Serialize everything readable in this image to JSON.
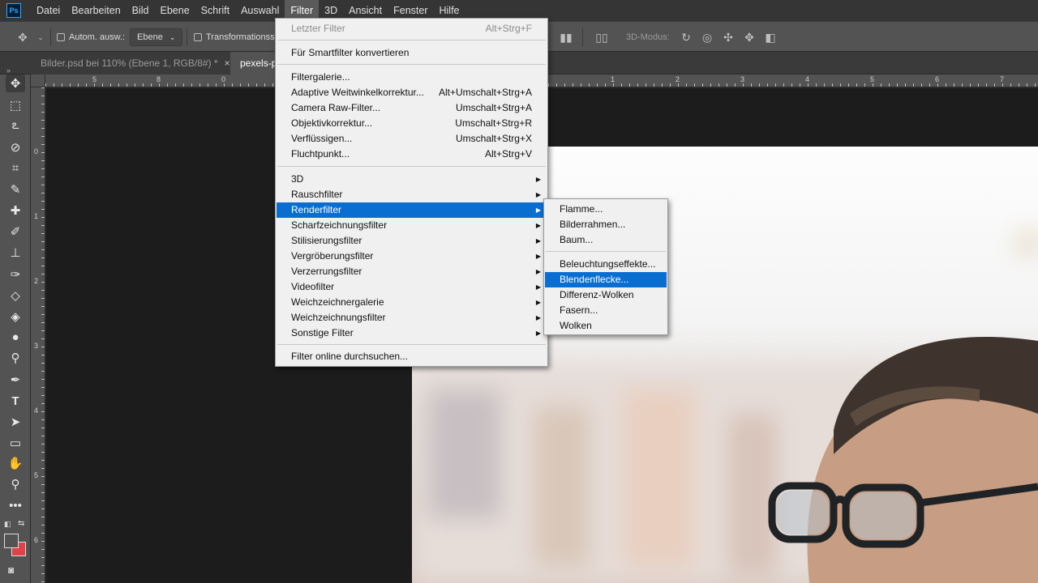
{
  "menubar": {
    "logo": "Ps",
    "items": [
      "Datei",
      "Bearbeiten",
      "Bild",
      "Ebene",
      "Schrift",
      "Auswahl",
      "Filter",
      "3D",
      "Ansicht",
      "Fenster",
      "Hilfe"
    ]
  },
  "options": {
    "auto_select_label": "Autom. ausw.:",
    "layer_dropdown": "Ebene",
    "transform_label": "Transformationsstrg.",
    "mode_3d_label": "3D-Modus:"
  },
  "tabs": [
    {
      "label": "Bilder.psd bei 110% (Ebene 1, RGB/8#) *",
      "close": "×"
    },
    {
      "label": "pexels-p",
      "close": ""
    }
  ],
  "ruler": {
    "top": [
      "5",
      "0",
      "1",
      "2",
      "3",
      "4",
      "5",
      "6",
      "7",
      "8",
      "9"
    ],
    "left": [
      "0",
      "1",
      "2",
      "3",
      "4",
      "5",
      "6"
    ]
  },
  "filter_menu": {
    "items": [
      {
        "label": "Letzter Filter",
        "shortcut": "Alt+Strg+F",
        "disabled": true
      },
      {
        "label": "Für Smartfilter konvertieren",
        "shortcut": ""
      },
      {
        "label": "Filtergalerie...",
        "shortcut": ""
      },
      {
        "label": "Adaptive Weitwinkelkorrektur...",
        "shortcut": "Alt+Umschalt+Strg+A"
      },
      {
        "label": "Camera Raw-Filter...",
        "shortcut": "Umschalt+Strg+A"
      },
      {
        "label": "Objektivkorrektur...",
        "shortcut": "Umschalt+Strg+R"
      },
      {
        "label": "Verflüssigen...",
        "shortcut": "Umschalt+Strg+X"
      },
      {
        "label": "Fluchtpunkt...",
        "shortcut": "Alt+Strg+V"
      },
      {
        "label": "3D",
        "submenu": true
      },
      {
        "label": "Rauschfilter",
        "submenu": true
      },
      {
        "label": "Renderfilter",
        "submenu": true,
        "highlighted": true
      },
      {
        "label": "Scharfzeichnungsfilter",
        "submenu": true
      },
      {
        "label": "Stilisierungsfilter",
        "submenu": true
      },
      {
        "label": "Vergröberungsfilter",
        "submenu": true
      },
      {
        "label": "Verzerrungsfilter",
        "submenu": true
      },
      {
        "label": "Videofilter",
        "submenu": true
      },
      {
        "label": "Weichzeichnergalerie",
        "submenu": true
      },
      {
        "label": "Weichzeichnungsfilter",
        "submenu": true
      },
      {
        "label": "Sonstige Filter",
        "submenu": true
      },
      {
        "label": "Filter online durchsuchen..."
      }
    ]
  },
  "render_submenu": {
    "items": [
      "Flamme...",
      "Bilderrahmen...",
      "Baum...",
      "Beleuchtungseffekte...",
      "Blendenflecke...",
      "Differenz-Wolken",
      "Fasern...",
      "Wolken"
    ],
    "highlighted_index": 4
  },
  "colors": {
    "highlight": "#0a6ed1",
    "foreground_swatch": "#535353",
    "background_swatch": "#e0424a"
  }
}
